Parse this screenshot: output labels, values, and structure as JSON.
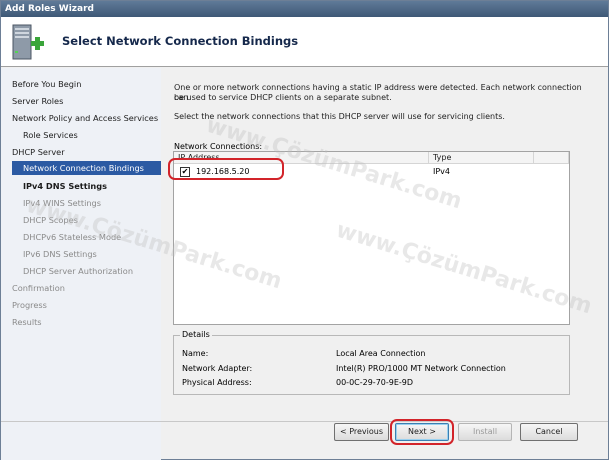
{
  "window": {
    "title": "Add Roles Wizard"
  },
  "header": {
    "title": "Select Network Connection Bindings"
  },
  "sidebar": {
    "items": [
      {
        "label": "Before You Begin",
        "state": "normal"
      },
      {
        "label": "Server Roles",
        "state": "normal"
      },
      {
        "label": "Network Policy and Access Services",
        "state": "normal"
      },
      {
        "label": "Role Services",
        "state": "normal"
      },
      {
        "label": "DHCP Server",
        "state": "normal"
      },
      {
        "label": "Network Connection Bindings",
        "state": "selected"
      },
      {
        "label": "IPv4 DNS Settings",
        "state": "bold"
      },
      {
        "label": "IPv4 WINS Settings",
        "state": "disabled"
      },
      {
        "label": "DHCP Scopes",
        "state": "disabled"
      },
      {
        "label": "DHCPv6 Stateless Mode",
        "state": "disabled"
      },
      {
        "label": "IPv6 DNS Settings",
        "state": "disabled"
      },
      {
        "label": "DHCP Server Authorization",
        "state": "disabled"
      },
      {
        "label": "Confirmation",
        "state": "disabled"
      },
      {
        "label": "Progress",
        "state": "disabled"
      },
      {
        "label": "Results",
        "state": "disabled"
      }
    ]
  },
  "content": {
    "intro_line1": "One or more network connections having a static IP address were detected. Each network connection can",
    "intro_line2": "be used to service DHCP clients on a separate subnet.",
    "instruction": "Select the network connections that this DHCP server will use for servicing clients.",
    "list_label": "Network Connections:",
    "columns": [
      "IP Address",
      "Type"
    ],
    "rows": [
      {
        "checked": true,
        "check_glyph": "✔",
        "ip": "192.168.5.20",
        "type": "IPv4"
      }
    ]
  },
  "details": {
    "legend": "Details",
    "fields": [
      {
        "label": "Name:",
        "value": "Local Area Connection"
      },
      {
        "label": "Network Adapter:",
        "value": "Intel(R) PRO/1000 MT Network Connection"
      },
      {
        "label": "Physical Address:",
        "value": "00-0C-29-70-9E-9D"
      }
    ]
  },
  "buttons": {
    "previous": "< Previous",
    "next": "Next >",
    "install": "Install",
    "cancel": "Cancel"
  },
  "watermark": "www.ÇözümPark.com",
  "colors": {
    "title_bar": "#4a6585",
    "selection": "#2b5aa3",
    "highlight_oval": "#d2242a",
    "header_text": "#15284b"
  }
}
